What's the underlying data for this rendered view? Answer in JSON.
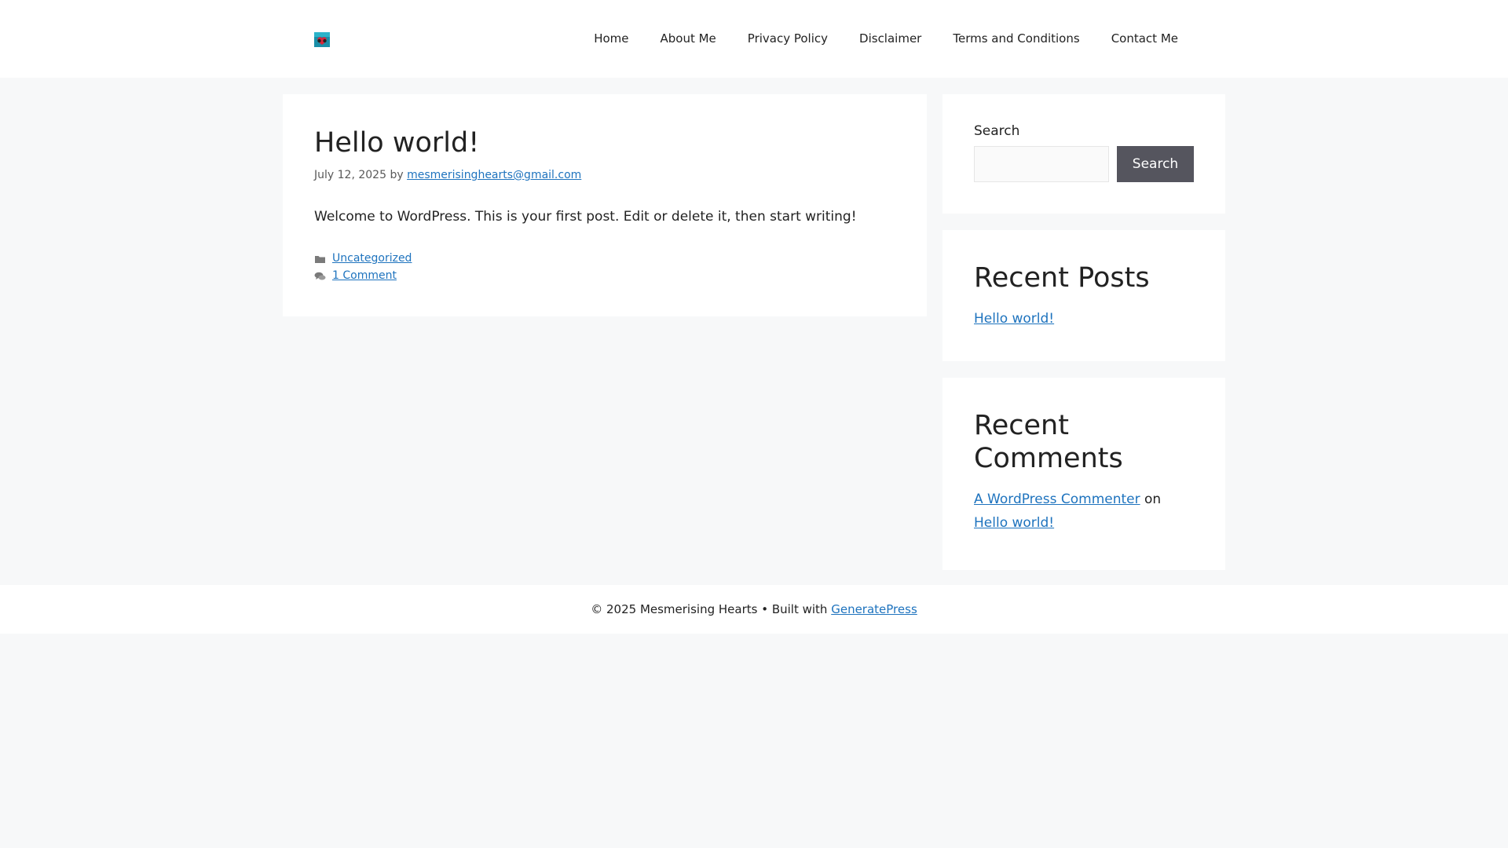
{
  "header": {
    "logo_icon": "site-logo-icon",
    "nav": [
      {
        "label": "Home"
      },
      {
        "label": "About Me"
      },
      {
        "label": "Privacy Policy"
      },
      {
        "label": "Disclaimer"
      },
      {
        "label": "Terms and Conditions"
      },
      {
        "label": "Contact Me"
      }
    ]
  },
  "post": {
    "title": "Hello world!",
    "date": "July 12, 2025",
    "by": "by",
    "author": "mesmerisinghearts@gmail.com",
    "content": "Welcome to WordPress. This is your first post. Edit or delete it, then start writing!",
    "category_icon": "folder-icon",
    "category": "Uncategorized",
    "comments_icon": "comments-icon",
    "comments": "1 Comment"
  },
  "sidebar": {
    "search": {
      "label": "Search",
      "placeholder": "",
      "button": "Search"
    },
    "recent_posts": {
      "title": "Recent Posts",
      "items": [
        {
          "label": "Hello world!"
        }
      ]
    },
    "recent_comments": {
      "title": "Recent Comments",
      "author": "A WordPress Commenter",
      "on": "on",
      "post": "Hello world!"
    }
  },
  "footer": {
    "copyright": "© 2025 Mesmerising Hearts • Built with",
    "link": "GeneratePress"
  },
  "colors": {
    "link": "#1e73be",
    "background": "#f7f8f9",
    "button": "#55555e"
  }
}
